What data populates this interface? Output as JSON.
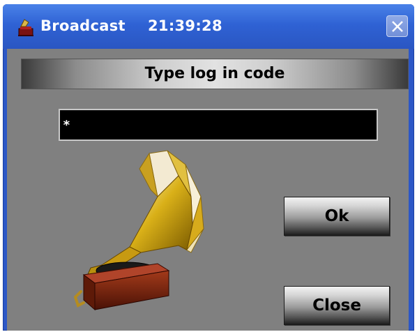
{
  "window": {
    "app_name": "Broadcast",
    "clock": "21:39:28"
  },
  "dialog": {
    "heading": "Type log in code",
    "code_input_value": "*",
    "ok_label": "Ok",
    "close_label": "Close"
  },
  "colors": {
    "titlebar": "#2f62d4",
    "client_background": "#808080",
    "input_background": "#000000"
  },
  "icons": {
    "title": "gramophone-icon",
    "close": "close-icon",
    "illustration": "gramophone-illustration"
  }
}
